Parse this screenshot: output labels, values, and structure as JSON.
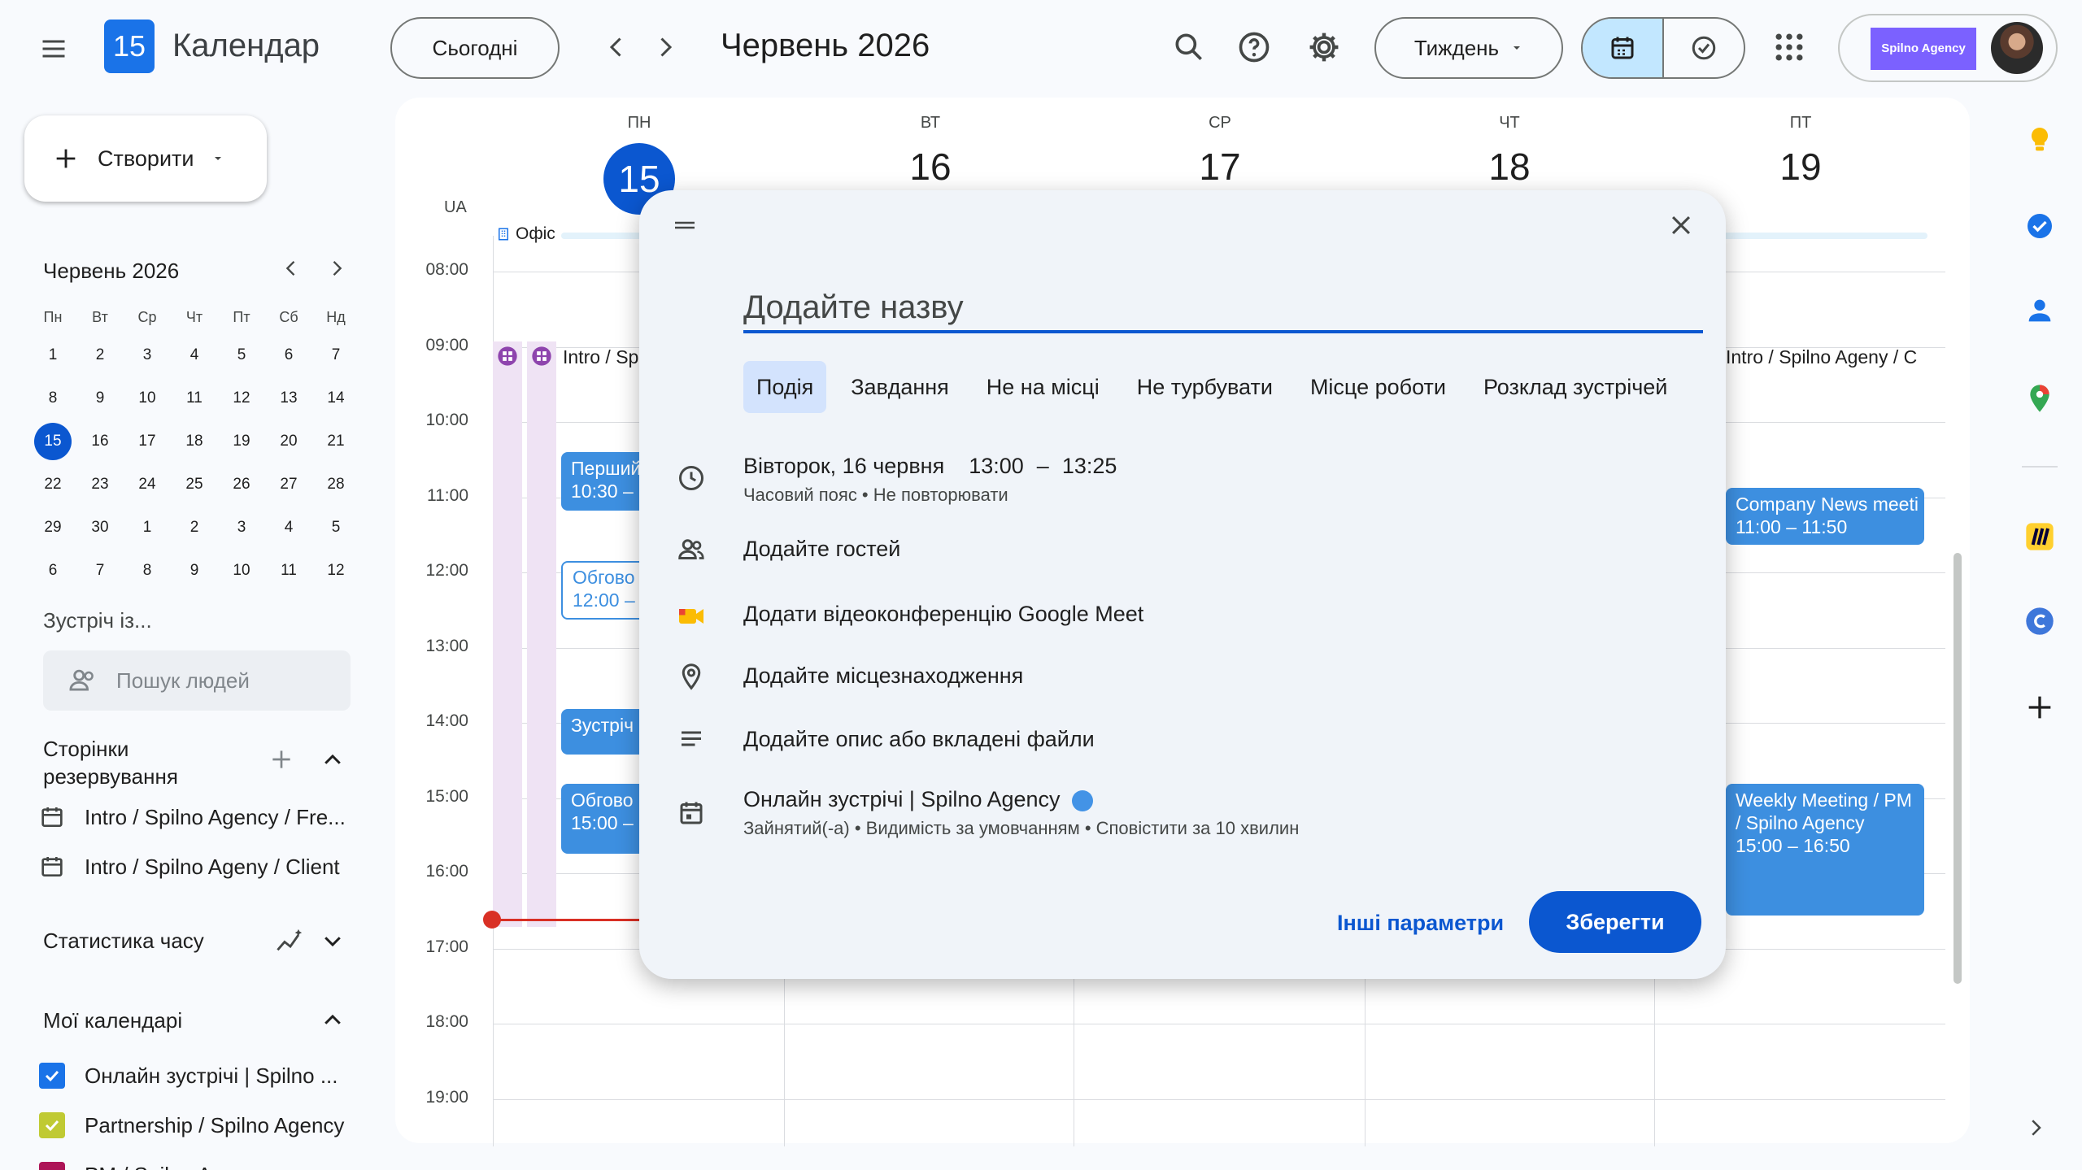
{
  "header": {
    "app_title": "Календар",
    "logo_day": "15",
    "today_button": "Сьогодні",
    "month_title": "Червень 2026",
    "view_select": "Тиждень",
    "brand_label": "Spilno Agency"
  },
  "sidebar": {
    "create_button": "Створити",
    "mini_calendar": {
      "title": "Червень 2026",
      "weekdays": [
        "Пн",
        "Вт",
        "Ср",
        "Чт",
        "Пт",
        "Сб",
        "Нд"
      ],
      "weeks": [
        [
          "1",
          "2",
          "3",
          "4",
          "5",
          "6",
          "7"
        ],
        [
          "8",
          "9",
          "10",
          "11",
          "12",
          "13",
          "14"
        ],
        [
          "15",
          "16",
          "17",
          "18",
          "19",
          "20",
          "21"
        ],
        [
          "22",
          "23",
          "24",
          "25",
          "26",
          "27",
          "28"
        ],
        [
          "29",
          "30",
          "1",
          "2",
          "3",
          "4",
          "5"
        ],
        [
          "6",
          "7",
          "8",
          "9",
          "10",
          "11",
          "12"
        ]
      ],
      "selected_day": "15"
    },
    "meet_with_label": "Зустріч із...",
    "people_search_placeholder": "Пошук людей",
    "booking_pages_title": "Сторінки резервування",
    "booking_pages": [
      "Intro / Spilno Agency / Fre...",
      "Intro / Spilno Ageny / Client"
    ],
    "time_insights_title": "Статистика часу",
    "my_calendars_title": "Мої календарі",
    "my_calendars": [
      {
        "label": "Онлайн зустрічі | Spilno ...",
        "color": "#1a73e8"
      },
      {
        "label": "Partnership / Spilno Agency",
        "color": "#c0ca33"
      },
      {
        "label": "PM / Spilno A...",
        "color": "#ad1457"
      }
    ]
  },
  "week": {
    "timezone": "UA",
    "days": [
      {
        "dow": "ПН",
        "date": "15"
      },
      {
        "dow": "ВТ",
        "date": "16"
      },
      {
        "dow": "СР",
        "date": "17"
      },
      {
        "dow": "ЧТ",
        "date": "18"
      },
      {
        "dow": "ПТ",
        "date": "19"
      }
    ],
    "hours": [
      "08:00",
      "09:00",
      "10:00",
      "11:00",
      "12:00",
      "13:00",
      "14:00",
      "15:00",
      "16:00",
      "17:00",
      "18:00",
      "19:00"
    ],
    "office_label": "Офіс",
    "events": {
      "mon_intro": "Intro / Sp",
      "mon_first_title": "Перший",
      "mon_first_time": "10:30 –",
      "mon_discuss_title": "Обгово",
      "mon_discuss_time": "12:00 –",
      "mon_meeting": "Зустріч",
      "mon_discuss2_title": "Обгово",
      "mon_discuss2_time": "15:00 –",
      "fri_intro": "Intro / Spilno Ageny / C",
      "fri_news_title": "Company News meeti",
      "fri_news_time": "11:00 – 11:50",
      "fri_weekly_title": "Weekly Meeting / PM / Spilno Agency",
      "fri_weekly_time": "15:00 – 16:50"
    }
  },
  "dialog": {
    "title_placeholder": "Додайте назву",
    "tabs": [
      "Подія",
      "Завдання",
      "Не на місці",
      "Не турбувати",
      "Місце роботи",
      "Розклад зустрічей"
    ],
    "date": "Вівторок, 16 червня",
    "time_start": "13:00",
    "time_dash": "–",
    "time_end": "13:25",
    "time_sub": "Часовий пояс • Не повторювати",
    "guests": "Додайте гостей",
    "meet": "Додати відеоконференцію Google Meet",
    "location": "Додайте місцезнаходження",
    "description": "Додайте опис або вкладені файли",
    "calendar": "Онлайн зустрічі | Spilno Agency",
    "calendar_color": "#4393e6",
    "calendar_sub": "Зайнятий(-а) • Видимість за умовчанням • Сповістити за 10 хвилин",
    "more_options": "Інші параметри",
    "save": "Зберегти"
  }
}
